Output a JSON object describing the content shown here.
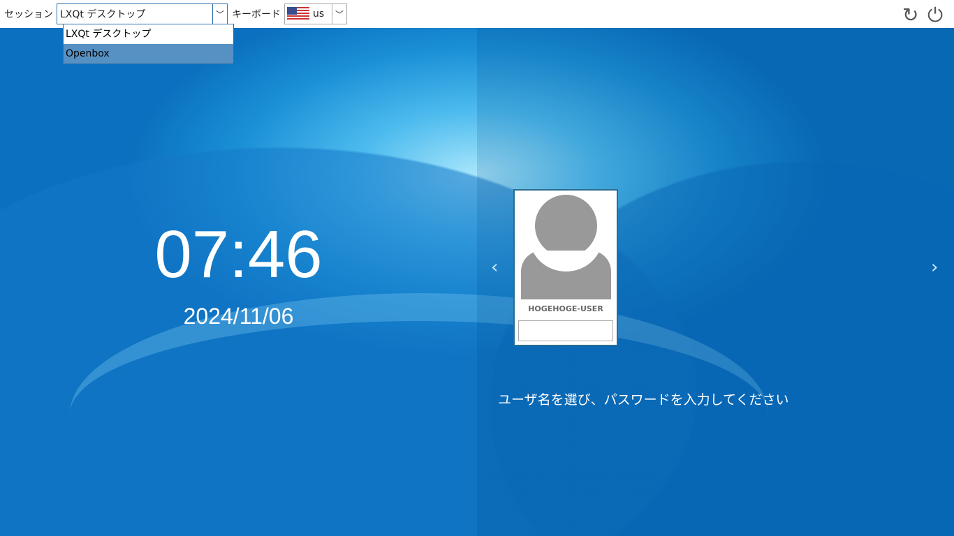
{
  "topbar": {
    "session_label": "セッション",
    "session_value": "LXQt デスクトップ",
    "keyboard_label": "キーボード",
    "keyboard_value": "us",
    "session_options": [
      "LXQt デスクトップ",
      "Openbox"
    ]
  },
  "clock": {
    "time": "07:46",
    "date": "2024/11/06"
  },
  "user": {
    "name": "HOGEHOGE-USER",
    "password": ""
  },
  "hint": "ユーザ名を選び、パスワードを入力してください",
  "icons": {
    "reboot": "↻",
    "shutdown": "⏻",
    "prev": "‹",
    "next": "›",
    "chevron": "﹀"
  }
}
